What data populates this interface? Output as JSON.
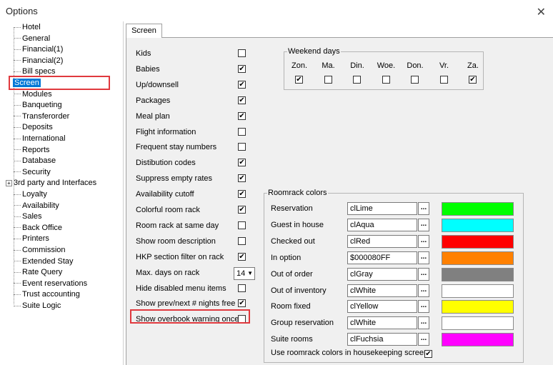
{
  "window": {
    "title": "Options",
    "close_glyph": "✕"
  },
  "tree": {
    "items": [
      {
        "label": "Hotel"
      },
      {
        "label": "General"
      },
      {
        "label": "Financial(1)"
      },
      {
        "label": "Financial(2)"
      },
      {
        "label": "Bill specs"
      },
      {
        "label": "Screen",
        "selected": true
      },
      {
        "label": "Modules"
      },
      {
        "label": "Banqueting"
      },
      {
        "label": "Transferorder"
      },
      {
        "label": "Deposits"
      },
      {
        "label": "International"
      },
      {
        "label": "Reports"
      },
      {
        "label": "Database"
      },
      {
        "label": "Security"
      },
      {
        "label": "3rd party and Interfaces",
        "expandable": true
      },
      {
        "label": "Loyalty"
      },
      {
        "label": "Availability"
      },
      {
        "label": "Sales"
      },
      {
        "label": "Back Office"
      },
      {
        "label": "Printers"
      },
      {
        "label": "Commission"
      },
      {
        "label": "Extended Stay"
      },
      {
        "label": "Rate Query"
      },
      {
        "label": "Event reservations"
      },
      {
        "label": "Trust accounting"
      },
      {
        "label": "Suite Logic"
      }
    ]
  },
  "tab": {
    "label": "Screen"
  },
  "options": [
    {
      "label": "Kids",
      "checked": false
    },
    {
      "label": "Babies",
      "checked": true
    },
    {
      "label": "Up/downsell",
      "checked": true
    },
    {
      "label": "Packages",
      "checked": true
    },
    {
      "label": "Meal plan",
      "checked": true
    },
    {
      "label": "Flight information",
      "checked": false
    },
    {
      "label": "Frequent stay numbers",
      "checked": false
    },
    {
      "label": "Distibution codes",
      "checked": true
    },
    {
      "label": "Suppress empty rates",
      "checked": true
    },
    {
      "label": "Availability cutoff",
      "checked": true
    },
    {
      "label": "Colorful room rack",
      "checked": true
    },
    {
      "label": "Room rack at same day",
      "checked": false
    },
    {
      "label": "Show room description",
      "checked": false
    },
    {
      "label": "HKP section filter on rack",
      "checked": true
    },
    {
      "label": "Max. days on rack",
      "dropdown": "14"
    },
    {
      "label": "Hide disabled menu items",
      "checked": false
    },
    {
      "label": "Show prev/next # nights free",
      "checked": true
    },
    {
      "label": "Show overbook warning once",
      "checked": false
    }
  ],
  "weekend": {
    "legend": "Weekend days",
    "days": [
      {
        "label": "Zon.",
        "checked": true
      },
      {
        "label": "Ma.",
        "checked": false
      },
      {
        "label": "Din.",
        "checked": false
      },
      {
        "label": "Woe.",
        "checked": false
      },
      {
        "label": "Don.",
        "checked": false
      },
      {
        "label": "Vr.",
        "checked": false
      },
      {
        "label": "Za.",
        "checked": true
      }
    ]
  },
  "roomrack": {
    "legend": "Roomrack colors",
    "rows": [
      {
        "label": "Reservation",
        "value": "clLime",
        "color": "#00ff00"
      },
      {
        "label": "Guest in house",
        "value": "clAqua",
        "color": "#00ffff"
      },
      {
        "label": "Checked out",
        "value": "clRed",
        "color": "#ff0000"
      },
      {
        "label": "In option",
        "value": "$000080FF",
        "color": "#ff8000"
      },
      {
        "label": "Out of order",
        "value": "clGray",
        "color": "#808080"
      },
      {
        "label": "Out of inventory",
        "value": "clWhite",
        "color": "#ffffff"
      },
      {
        "label": "Room fixed",
        "value": "clYellow",
        "color": "#ffff00"
      },
      {
        "label": "Group reservation",
        "value": "clWhite",
        "color": "#ffffff"
      },
      {
        "label": "Suite rooms",
        "value": "clFuchsia",
        "color": "#ff00ff"
      }
    ],
    "button_label": "...",
    "housekeeping": {
      "label": "Use roomrack colors in housekeeping screen",
      "checked": true
    }
  },
  "colors": {
    "selection": "#0078d7",
    "highlight": "#e0393e"
  }
}
